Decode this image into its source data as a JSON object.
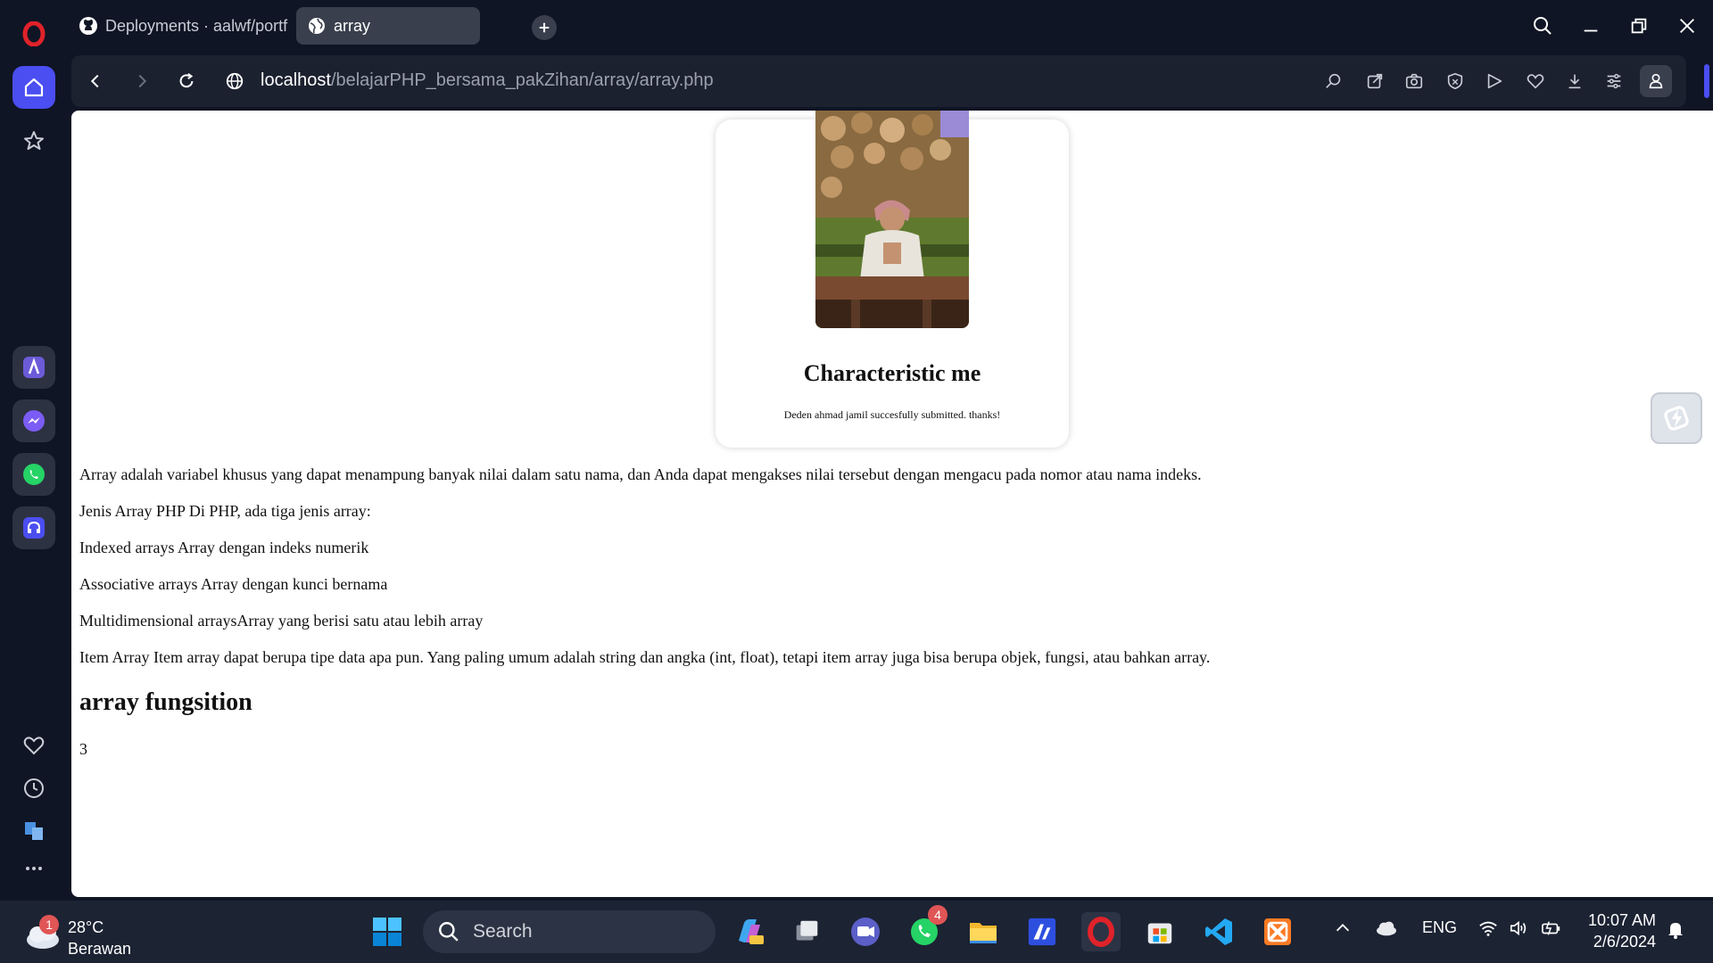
{
  "browser": {
    "tabs": [
      {
        "title": "Deployments · aalwf/portf",
        "icon": "github-icon",
        "active": false
      },
      {
        "title": "array",
        "icon": "globe-icon",
        "active": true
      }
    ],
    "url_host": "localhost",
    "url_path": "/belajarPHP_bersama_pakZihan/array/array.php"
  },
  "card": {
    "title": "Characteristic me",
    "subtitle": "Deden ahmad jamil succesfully submitted. thanks!"
  },
  "content": {
    "paragraphs": [
      "Array adalah variabel khusus yang dapat menampung banyak nilai dalam satu nama, dan Anda dapat mengakses nilai tersebut dengan mengacu pada nomor atau nama indeks.",
      "Jenis Array PHP Di PHP, ada tiga jenis array:",
      "Indexed arrays Array dengan indeks numerik",
      "Associative arrays Array dengan kunci bernama",
      "Multidimensional arraysArray yang berisi satu atau lebih array",
      "Item Array Item array dapat berupa tipe data apa pun. Yang paling umum adalah string dan angka (int, float), tetapi item array juga bisa berupa objek, fungsi, atau bahkan array."
    ],
    "heading": "array fungsition",
    "result": "3"
  },
  "taskbar": {
    "weather_temp": "28°C",
    "weather_desc": "Berawan",
    "weather_badge": "1",
    "search_placeholder": "Search",
    "whatsapp_badge": "4",
    "language": "ENG",
    "time": "10:07 AM",
    "date": "2/6/2024"
  },
  "colors": {
    "accent": "#4b4ef0",
    "browser_bg": "#0f1524",
    "opera_red": "#e0222a"
  }
}
